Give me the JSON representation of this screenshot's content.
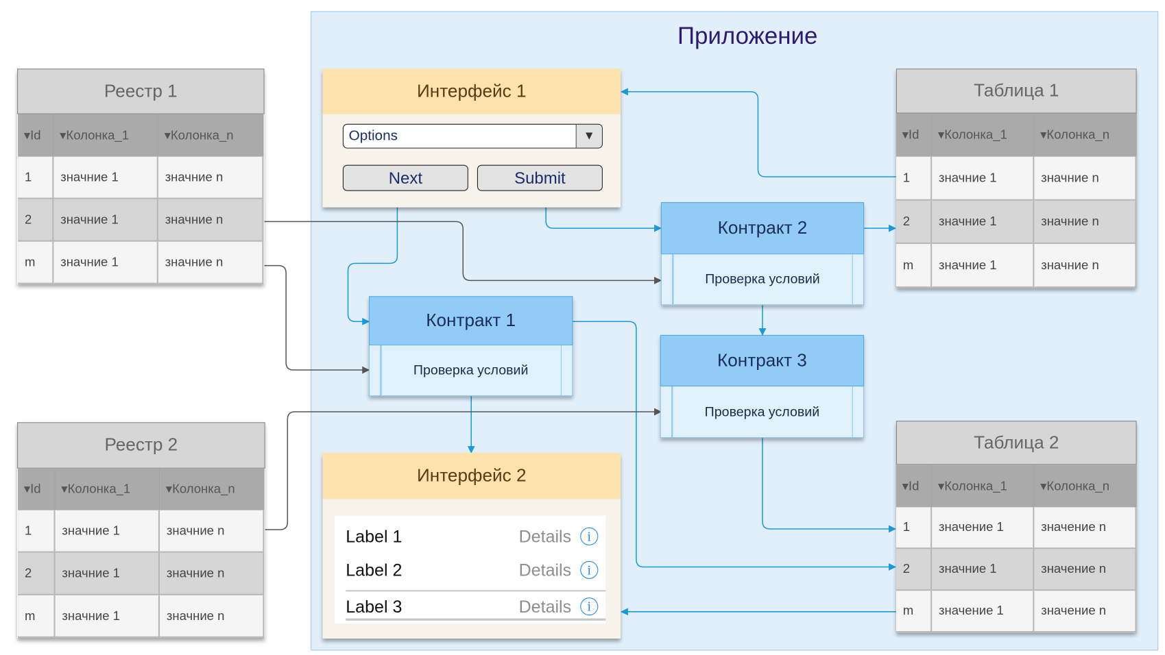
{
  "app": {
    "title": "Приложение"
  },
  "colors": {
    "connector_blue": "#1a9ad9",
    "connector_gray": "#555555",
    "interface_header": "#fde2ad",
    "contract_header": "#92cbf6",
    "app_bg": "#e1effb"
  },
  "registries": [
    {
      "title": "Реестр 1",
      "columns": [
        "▾Id",
        "▾Колонка_1",
        "▾Колонка_n"
      ],
      "rows": [
        [
          "1",
          "значние 1",
          "значние n"
        ],
        [
          "2",
          "значние 1",
          "значние n"
        ],
        [
          "m",
          "значние 1",
          "значние n"
        ]
      ]
    },
    {
      "title": "Реестр 2",
      "columns": [
        "▾Id",
        "▾Колонка_1",
        "▾Колонка_n"
      ],
      "rows": [
        [
          "1",
          "значние 1",
          "значние n"
        ],
        [
          "2",
          "значние 1",
          "значние n"
        ],
        [
          "m",
          "значние 1",
          "значние n"
        ]
      ]
    }
  ],
  "tables": [
    {
      "title": "Таблица 1",
      "columns": [
        "▾Id",
        "▾Колонка_1",
        "▾Колонка_n"
      ],
      "rows": [
        [
          "1",
          "значние 1",
          "значние n"
        ],
        [
          "2",
          "значние 1",
          "значние n"
        ],
        [
          "m",
          "значние 1",
          "значние n"
        ]
      ]
    },
    {
      "title": "Таблица 2",
      "columns": [
        "▾Id",
        "▾Колонка_1",
        "▾Колонка_n"
      ],
      "rows": [
        [
          "1",
          "значение 1",
          "значение n"
        ],
        [
          "2",
          "значние 1",
          "значение n"
        ],
        [
          "m",
          "значение 1",
          "значение n"
        ]
      ]
    }
  ],
  "interface1": {
    "title": "Интерфейс 1",
    "dropdown": {
      "value": "Options",
      "icon": "triangle-down"
    },
    "buttons": {
      "next": "Next",
      "submit": "Submit"
    }
  },
  "interface2": {
    "title": "Интерфейс 2",
    "items": [
      {
        "label": "Label 1",
        "details": "Details",
        "icon": "info"
      },
      {
        "label": "Label 2",
        "details": "Details",
        "icon": "info"
      },
      {
        "label": "Label 3",
        "details": "Details",
        "icon": "info"
      }
    ]
  },
  "contracts": [
    {
      "title": "Контракт 1",
      "body": "Проверка условий"
    },
    {
      "title": "Контракт 2",
      "body": "Проверка условий"
    },
    {
      "title": "Контракт 3",
      "body": "Проверка условий"
    }
  ],
  "info_glyph": "i",
  "dropdown_glyph": "▼"
}
